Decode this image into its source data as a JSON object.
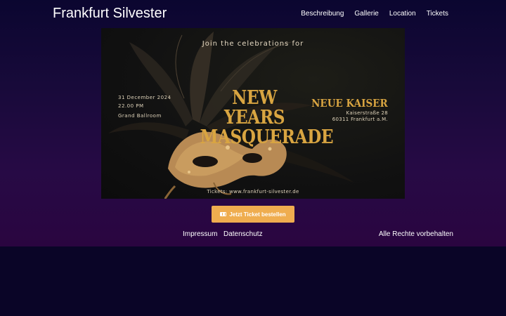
{
  "header": {
    "brand": "Frankfurt Silvester",
    "nav": [
      "Beschreibung",
      "Gallerie",
      "Location",
      "Tickets"
    ]
  },
  "hero": {
    "join": "Join the celebrations for",
    "date": "31 December 2024",
    "time": "22.00 PM",
    "room": "Grand Ballroom",
    "title_line1": "NEW YEARS",
    "title_line2": "MASQUERADE",
    "venue": "NEUE KAISER",
    "street": "Kaiserstraße 28",
    "city": "60311 Frankfurt a.M.",
    "tickets": "Tickets: www.frankfurt-silvester.de"
  },
  "cta": {
    "label": "Jetzt Ticket bestellen",
    "icon": "ticket-icon",
    "color": "#efad4f"
  },
  "footer": {
    "impressum": "Impressum",
    "datenschutz": "Datenschutz",
    "rights": "Alle Rechte vorbehalten"
  },
  "colors": {
    "accent": "#efad4f",
    "gold": "#d9a541",
    "background_top": "#0b0630",
    "background_bottom": "#2a0540"
  }
}
